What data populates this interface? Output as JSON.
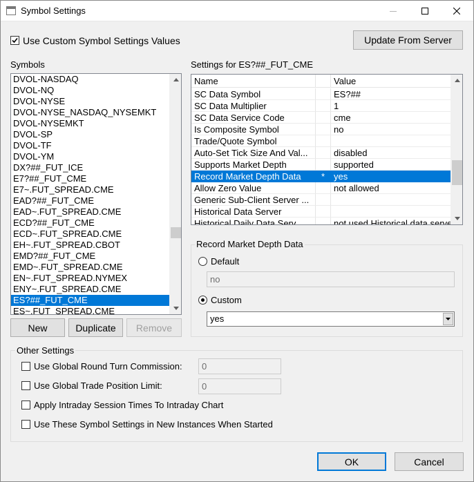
{
  "window": {
    "title": "Symbol Settings",
    "controls": [
      "minimize-icon",
      "maximize-icon",
      "close-icon"
    ]
  },
  "use_custom": {
    "label": "Use Custom Symbol Settings Values",
    "checked": true
  },
  "update_button": "Update From Server",
  "symbols": {
    "label": "Symbols",
    "items": [
      "DVOL-NASDAQ",
      "DVOL-NQ",
      "DVOL-NYSE",
      "DVOL-NYSE_NASDAQ_NYSEMKT",
      "DVOL-NYSEMKT",
      "DVOL-SP",
      "DVOL-TF",
      "DVOL-YM",
      "DX?##_FUT_ICE",
      "E7?##_FUT_CME",
      "E7~.FUT_SPREAD.CME",
      "EAD?##_FUT_CME",
      "EAD~.FUT_SPREAD.CME",
      "ECD?##_FUT_CME",
      "ECD~.FUT_SPREAD.CME",
      "EH~.FUT_SPREAD.CBOT",
      "EMD?##_FUT_CME",
      "EMD~.FUT_SPREAD.CME",
      "EN~.FUT_SPREAD.NYMEX",
      "ENY~.FUT_SPREAD.CME",
      "ES?##_FUT_CME",
      "ES~.FUT_SPREAD.CME"
    ],
    "selected_index": 20
  },
  "list_buttons": {
    "new": "New",
    "duplicate": "Duplicate",
    "remove": "Remove"
  },
  "settings": {
    "label": "Settings for ES?##_FUT_CME",
    "col_name": "Name",
    "col_value": "Value",
    "rows": [
      {
        "name": "SC Data Symbol",
        "star": "",
        "value": "ES?##"
      },
      {
        "name": "SC Data Multiplier",
        "star": "",
        "value": "1"
      },
      {
        "name": "SC Data Service Code",
        "star": "",
        "value": "cme"
      },
      {
        "name": "Is Composite Symbol",
        "star": "",
        "value": "no"
      },
      {
        "name": "Trade/Quote Symbol",
        "star": "",
        "value": ""
      },
      {
        "name": "Auto-Set Tick Size And Val...",
        "star": "",
        "value": "disabled"
      },
      {
        "name": "Supports Market Depth",
        "star": "",
        "value": "supported"
      },
      {
        "name": "Record Market Depth Data",
        "star": "*",
        "value": "yes"
      },
      {
        "name": "Allow Zero Value",
        "star": "",
        "value": "not allowed"
      },
      {
        "name": "Generic Sub-Client Server ...",
        "star": "",
        "value": ""
      },
      {
        "name": "Historical Data Server",
        "star": "",
        "value": ""
      },
      {
        "name": "Historical Daily Data Serv...",
        "star": "",
        "value": "not used Historical data server"
      }
    ],
    "selected_index": 7
  },
  "detail": {
    "title": "Record Market Depth Data",
    "default_label": "Default",
    "default_value": "no",
    "custom_label": "Custom",
    "custom_value": "yes",
    "selected": "custom"
  },
  "other_settings": {
    "title": "Other Settings",
    "round_turn": {
      "label": "Use Global Round Turn Commission:",
      "value": "0",
      "checked": false
    },
    "trade_limit": {
      "label": "Use Global Trade Position Limit:",
      "value": "0",
      "checked": false
    },
    "intraday": {
      "label": "Apply Intraday Session Times To Intraday Chart",
      "checked": false
    },
    "new_instances": {
      "label": "Use These Symbol Settings in New Instances When Started",
      "checked": false
    }
  },
  "footer": {
    "ok": "OK",
    "cancel": "Cancel"
  }
}
